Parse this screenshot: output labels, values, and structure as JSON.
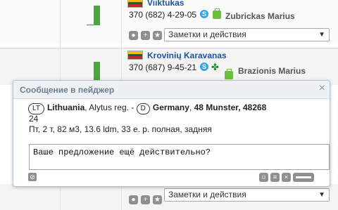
{
  "rows": [
    {
      "company": "Viiktukas",
      "phone": "370 (682) 4-29-05",
      "person": "Zubrickas Marius",
      "actions_label": "Заметки и действия"
    },
    {
      "company": "Krovinių Karavanas",
      "phone": "370 (687) 9-45-21",
      "person": "Brazionis Marius"
    },
    {
      "actions_label": "Заметки и действия"
    }
  ],
  "pager": {
    "title": "Сообщение в пейджер",
    "from_code": "LT",
    "from_country": "Lithuania",
    "from_region": "Alytus reg. -",
    "to_code": "D",
    "to_country": "Germany",
    "to_place": "48 Munster, 48268",
    "count": "24",
    "details": "Пт, 2 т, 82 м3, 13.6 ldm, 33 е. р. полная, задняя",
    "message": "Ваше предложение ещё действительно?"
  },
  "icons": {
    "skype": "skype-icon",
    "case": "briefcase-icon",
    "clover": "clover-icon",
    "eye": "eye-icon",
    "plus": "plus-icon",
    "star": "star-icon",
    "close": "close-icon",
    "clip": "attachment-icon",
    "smile": "smiley-icon",
    "list": "list-icon",
    "delete": "delete-icon",
    "send": "send-icon"
  },
  "colors": {
    "link": "#1a53a6",
    "bar": "#49a83a",
    "popup_title": "#6a7c92"
  }
}
